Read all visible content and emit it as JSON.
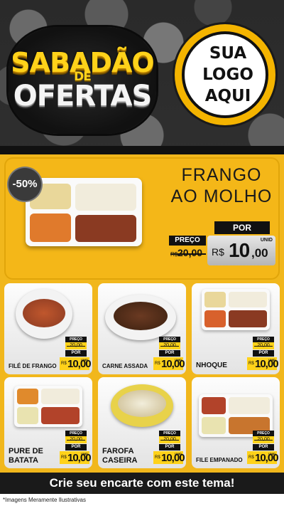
{
  "header": {
    "title_line1": "SABADÃO",
    "title_line2": "DE",
    "title_line3": "OFERTAS",
    "logo_line1": "SUA",
    "logo_line2": "LOGO",
    "logo_line3": "AQUI"
  },
  "hero": {
    "discount": "-50%",
    "name_line1": "FRANGO",
    "name_line2": "AO MOLHO",
    "preco_label": "PREÇO",
    "old_currency": "R$",
    "old_price": "20,00",
    "por_label": "POR",
    "new_currency": "R$",
    "new_price_int": "10",
    "new_price_dec": ",00",
    "unit": "UNID"
  },
  "products": [
    {
      "name": "FILÉ DE FRANGO",
      "preco_label": "PREÇO",
      "old_price": "20,00",
      "por_label": "POR",
      "currency": "R$",
      "price": "10,00",
      "unit": "UNID"
    },
    {
      "name": "CARNE ASSADA",
      "preco_label": "PREÇO",
      "old_price": "20,00",
      "por_label": "POR",
      "currency": "R$",
      "price": "10,00",
      "unit": "UNID"
    },
    {
      "name": "NHOQUE",
      "preco_label": "PREÇO",
      "old_price": "20,00",
      "por_label": "POR",
      "currency": "R$",
      "price": "10,00",
      "unit": "UNID"
    },
    {
      "name": "PURE DE BATATA",
      "preco_label": "PREÇO",
      "old_price": "20,00",
      "por_label": "POR",
      "currency": "R$",
      "price": "10,00",
      "unit": "UNID"
    },
    {
      "name": "FAROFA CASEIRA",
      "preco_label": "PREÇO",
      "old_price": "20,00",
      "por_label": "POR",
      "currency": "R$",
      "price": "10,00",
      "unit": "UNID"
    },
    {
      "name": "FILE EMPANADO",
      "preco_label": "PREÇO",
      "old_price": "20,00",
      "por_label": "POR",
      "currency": "R$",
      "price": "10,00",
      "unit": "UNID"
    }
  ],
  "footer": {
    "cta": "Crie seu encarte com este tema!",
    "disclaimer": "*Imagens Meramente Ilustrativas"
  },
  "colors": {
    "accent": "#f1b71c",
    "dark": "#111111"
  }
}
